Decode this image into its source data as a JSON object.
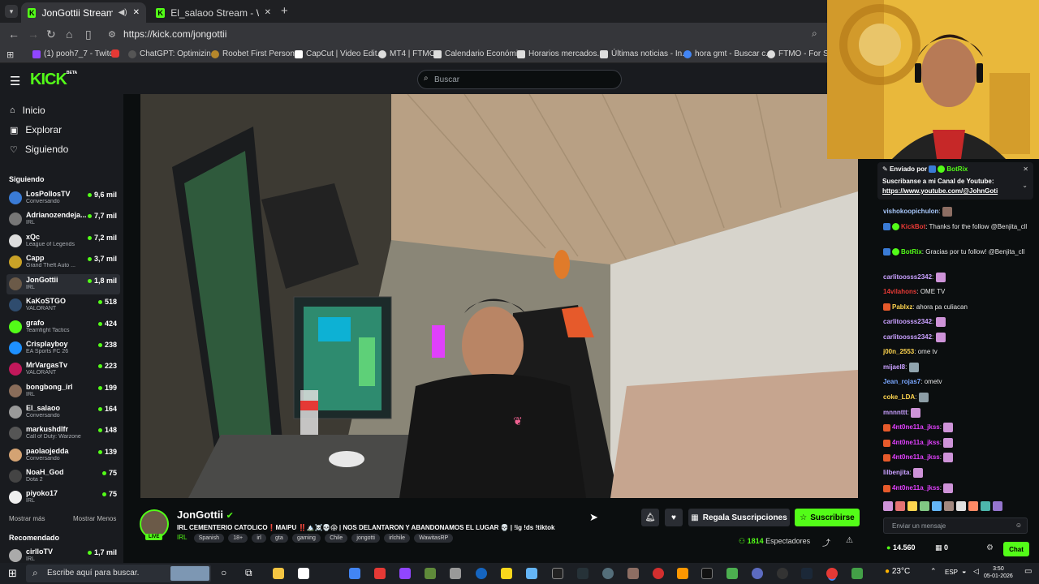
{
  "browser": {
    "tabs": [
      {
        "title": "JonGottii Stream - Watch Li"
      },
      {
        "title": "El_salaoo Stream - Watch Live o"
      }
    ],
    "new_tab": "+",
    "url": "https://kick.com/jongottii",
    "bookmarks": [
      {
        "label": "(1) pooh7_7 - Twitch",
        "color": "#9146ff"
      },
      {
        "label": "ChatGPT: Optimizin...",
        "color": "#333"
      },
      {
        "label": "Roobet First Person...",
        "color": "#b5872b"
      },
      {
        "label": "CapCut | Video Edit...",
        "color": "#fff"
      },
      {
        "label": "MT4 | FTMO",
        "color": "#ddd"
      },
      {
        "label": "Calendario Económi...",
        "color": "#ddd"
      },
      {
        "label": "Horarios mercados...",
        "color": "#ddd"
      },
      {
        "label": "Últimas noticias - In...",
        "color": "#ddd"
      },
      {
        "label": "hora gmt - Buscar c...",
        "color": "#4285f4"
      },
      {
        "label": "FTMO - For Serio",
        "color": "#ddd"
      }
    ]
  },
  "header": {
    "logo": "KICK",
    "logo_badge": "BETA",
    "search_placeholder": "Buscar"
  },
  "sidebar": {
    "nav": [
      {
        "label": "Inicio",
        "icon": "home-icon"
      },
      {
        "label": "Explorar",
        "icon": "compass-icon"
      },
      {
        "label": "Siguiendo",
        "icon": "heart-icon"
      }
    ],
    "following_title": "Siguiendo",
    "following": [
      {
        "name": "LosPollosTV",
        "category": "Conversando",
        "viewers": "9,6 mil",
        "color": "#3a7bd5"
      },
      {
        "name": "Adrianozendeja...",
        "category": "IRL",
        "viewers": "7,7 mil",
        "color": "#777"
      },
      {
        "name": "xQc",
        "category": "League of Legends",
        "viewers": "7,2 mil",
        "color": "#ddd"
      },
      {
        "name": "Capp",
        "category": "Grand Theft Auto ...",
        "viewers": "3,7 mil",
        "color": "#c9a227"
      },
      {
        "name": "JonGottii",
        "category": "IRL",
        "viewers": "1,8 mil",
        "color": "#6b5a48"
      },
      {
        "name": "KaKoSTGO",
        "category": "VALORANT",
        "viewers": "518",
        "color": "#2f4c6e"
      },
      {
        "name": "grafo",
        "category": "Teamfight Tactics",
        "viewers": "424",
        "color": "#53fc18"
      },
      {
        "name": "Crisplayboy",
        "category": "EA Sports FC 26",
        "viewers": "238",
        "color": "#1e90ff"
      },
      {
        "name": "MrVargasTv",
        "category": "VALORANT",
        "viewers": "223",
        "color": "#c2185b"
      },
      {
        "name": "bongbong_irl",
        "category": "IRL",
        "viewers": "199",
        "color": "#8a6d5a"
      },
      {
        "name": "El_salaoo",
        "category": "Conversando",
        "viewers": "164",
        "color": "#999"
      },
      {
        "name": "markushdlfr",
        "category": "Call of Duty: Warzone",
        "viewers": "148",
        "color": "#555"
      },
      {
        "name": "paolaojedda",
        "category": "Conversando",
        "viewers": "139",
        "color": "#d4a373"
      },
      {
        "name": "NoaH_God",
        "category": "Dota 2",
        "viewers": "75",
        "color": "#444"
      },
      {
        "name": "piyoko17",
        "category": "IRL",
        "viewers": "75",
        "color": "#eee"
      }
    ],
    "show_more": "Mostrar más",
    "show_less": "Mostrar Menos",
    "recommended_title": "Recomendado",
    "recommended": [
      {
        "name": "cirlloTV",
        "category": "IRL",
        "viewers": "1,7 mil",
        "color": "#aaa"
      }
    ]
  },
  "stream": {
    "channel": "JonGottii",
    "live_badge": "LIVE",
    "title": "IRL CEMENTERIO CATOLICO❗MAIPU ‼️🏔️☠️💀😱 | NOS DELANTARON Y ABANDONAMOS EL LUGAR 💀 | !ig !ds !tiktok",
    "category": "IRL",
    "tags": [
      "Spanish",
      "18+",
      "irl",
      "gta",
      "gaming",
      "Chile",
      "jongotti",
      "irlchile",
      "WawitasRP"
    ],
    "gift_button": "Regala Suscripciones",
    "subscribe_button": "Suscribirse",
    "viewers": "1814",
    "viewers_label": "Espectadores"
  },
  "chat": {
    "pinned_by": "Enviado por",
    "pinned_user": "BotRix",
    "pinned_text": "Suscribanse a mi Canal de Youtube:",
    "pinned_link": "https://www.youtube.com/@JohnGoti",
    "messages": [
      {
        "user": "vishokoopichulon",
        "color": "#a8c7fa",
        "text": ""
      },
      {
        "user": "KickBot",
        "color": "#e53935",
        "text": "Thanks for the follow @Benjita_cll"
      },
      {
        "user": "BotRix",
        "color": "#53fc18",
        "text": "Gracias por tu follow! @Benjita_cll"
      },
      {
        "user": "carlitoosss2342",
        "color": "#c9a0ff",
        "text": ""
      },
      {
        "user": "14vilahons",
        "color": "#e53935",
        "text": "OME TV"
      },
      {
        "user": "Pablxz",
        "color": "#ffd54f",
        "text": "ahora pa culiacan"
      },
      {
        "user": "carlitoosss2342",
        "color": "#c9a0ff",
        "text": ""
      },
      {
        "user": "carlitoosss2342",
        "color": "#c9a0ff",
        "text": ""
      },
      {
        "user": "j00n_2553",
        "color": "#ffd54f",
        "text": "ome tv"
      },
      {
        "user": "mijael8",
        "color": "#c9a0ff",
        "text": ""
      },
      {
        "user": "Jean_rojas7",
        "color": "#7aa7ff",
        "text": "ometv"
      },
      {
        "user": "coke_LDA",
        "color": "#ffd54f",
        "text": ""
      },
      {
        "user": "mnnnttt",
        "color": "#c9a0ff",
        "text": ""
      },
      {
        "user": "4nt0ne11a_jkss",
        "color": "#e040fb",
        "text": ""
      },
      {
        "user": "4nt0ne11a_jkss",
        "color": "#e040fb",
        "text": ""
      },
      {
        "user": "4nt0ne11a_jkss",
        "color": "#e040fb",
        "text": ""
      },
      {
        "user": "lilbenjita",
        "color": "#c9a0ff",
        "text": ""
      },
      {
        "user": "4nt0ne11a_jkss",
        "color": "#e040fb",
        "text": ""
      }
    ],
    "input_placeholder": "Enviar un mensaje",
    "points": "14.560",
    "zero": "0",
    "chat_button": "Chat"
  },
  "taskbar": {
    "search_placeholder": "Escribe aquí para buscar.",
    "weather": "23°C",
    "language": "ESP",
    "time": "3:50",
    "date": "05-01-2026"
  },
  "colors": {
    "kick_green": "#53fc18",
    "bg": "#0b0e0f",
    "panel": "#191b1f"
  }
}
